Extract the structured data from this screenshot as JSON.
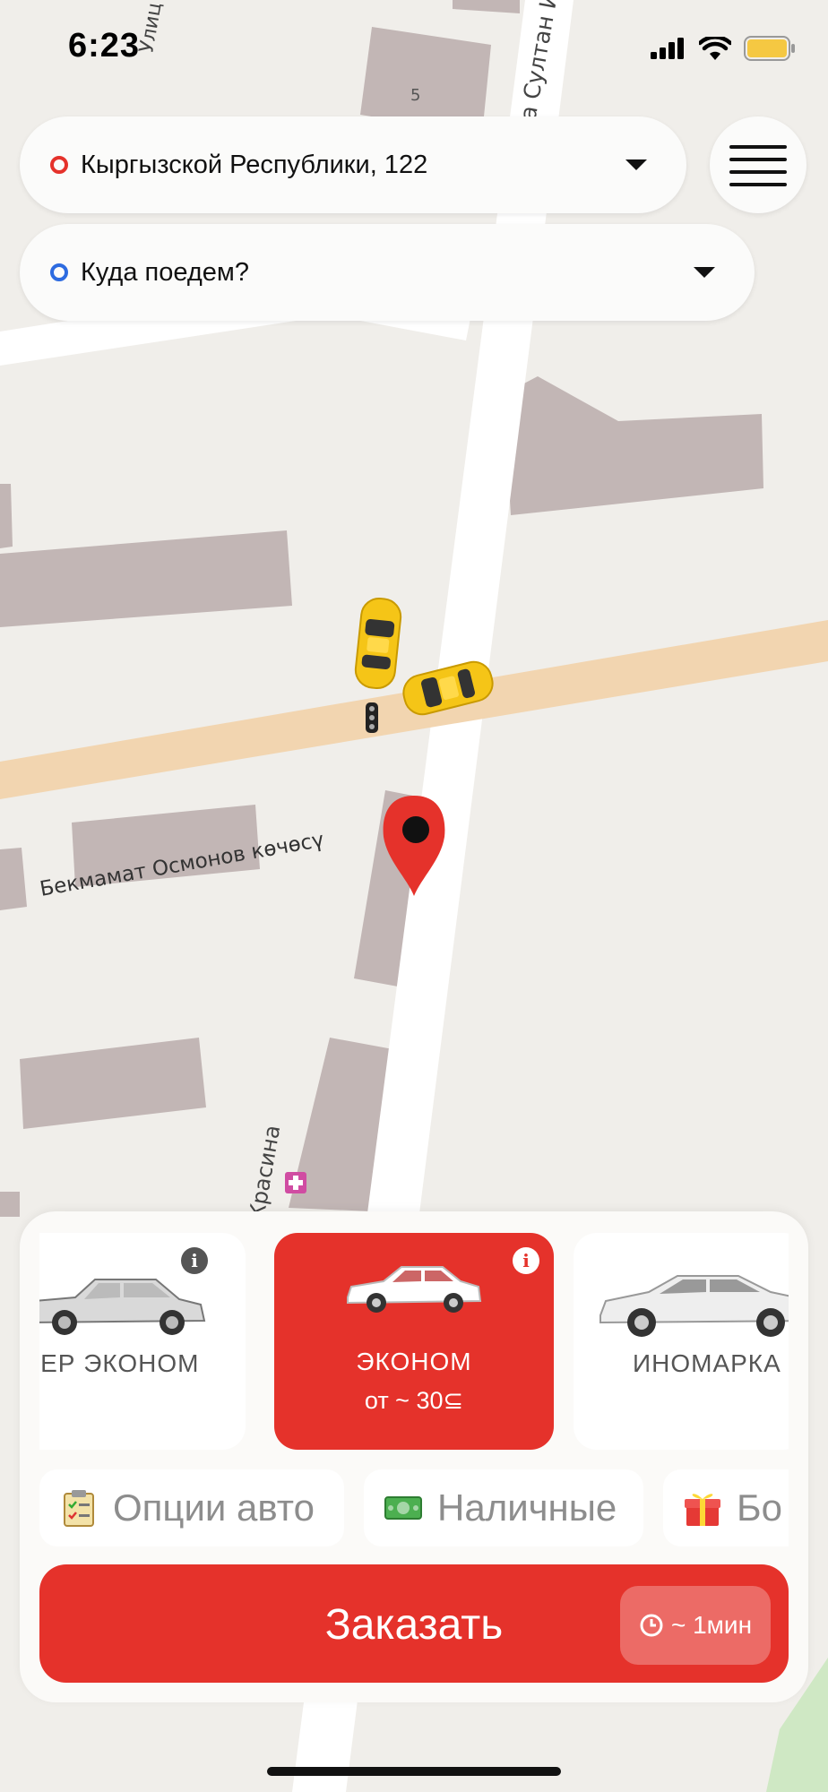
{
  "status": {
    "time": "6:23"
  },
  "from": {
    "address": "Кыргызской Республики, 122",
    "dot_color": "#e5322b"
  },
  "to": {
    "placeholder": "Куда поедем?",
    "dot_color": "#2d6be0"
  },
  "map": {
    "street_labels": [
      "улица Султан И",
      "Бекмамат Осмонов көчөсү",
      "Красина",
      "Улиц"
    ],
    "building_number": "5",
    "marker": "location-pin-icon",
    "cars": [
      "taxi-car-icon",
      "taxi-car-icon"
    ]
  },
  "tariffs": [
    {
      "label": "ПЕР ЭКОНОМ",
      "icon": "sedan-lada-icon",
      "info": "i"
    },
    {
      "label": "ЭКОНОМ",
      "price": "от ~ 30⊆",
      "active": true,
      "icon": "sedan-white-icon",
      "info": "i"
    },
    {
      "label": "ИНОМАРКА",
      "icon": "sedan-toyota-icon"
    }
  ],
  "options": [
    {
      "label": "Опции авто",
      "icon": "clipboard-icon"
    },
    {
      "label": "Наличные",
      "icon": "cash-icon"
    },
    {
      "label": "Бо",
      "icon": "gift-icon"
    }
  ],
  "order": {
    "label": "Заказать",
    "eta": "~ 1мин"
  },
  "colors": {
    "accent": "#e5322b",
    "road_main": "#f2d5b0",
    "building": "#c2b6b5",
    "map_bg": "#f0eeea"
  }
}
